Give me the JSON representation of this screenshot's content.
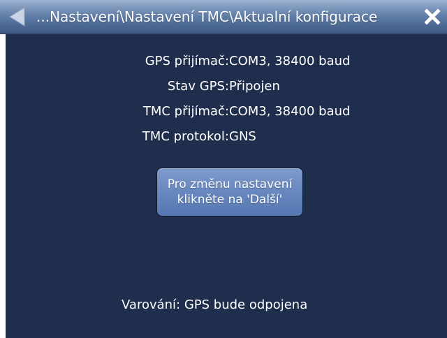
{
  "header": {
    "title": "...Nastavení\\Nastavení TMC\\Aktualní konfigurace",
    "back_icon": "back-arrow-icon",
    "close_icon": "close-icon"
  },
  "info": [
    {
      "label": "GPS přijímač:",
      "value": "COM3, 38400 baud"
    },
    {
      "label": "Stav GPS:",
      "value": "Připojen"
    },
    {
      "label": "TMC přijímač:",
      "value": "COM3, 38400 baud"
    },
    {
      "label": "TMC protokol:",
      "value": "GNS"
    }
  ],
  "button": {
    "label": "Pro změnu nastavení klikněte na 'Další'"
  },
  "warning": "Varování: GPS bude odpojena",
  "colors": {
    "background": "#1f2e4c",
    "titlebar": "#5f7ca6",
    "button": "#6a89c0",
    "text": "#ffffff"
  }
}
